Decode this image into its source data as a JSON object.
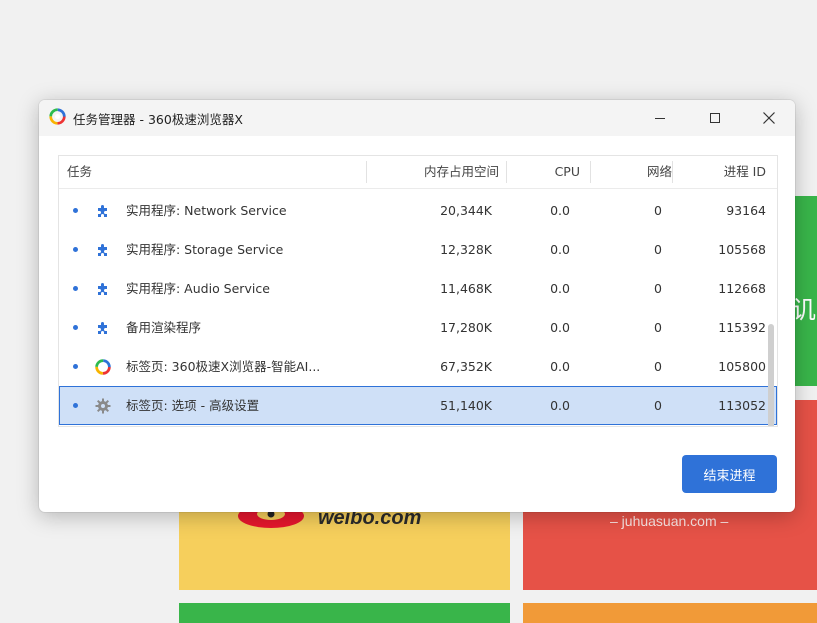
{
  "background": {
    "weibo_text": "weibo.com",
    "juhua_text": "– juhuasuan.com –",
    "edge_glyph": "讥",
    "colors": {
      "green": "#39b54a",
      "yellow": "#f6cf5c",
      "red": "#e65247",
      "orange": "#f19a38"
    }
  },
  "dialog": {
    "title": "任务管理器 - 360极速浏览器X",
    "window_controls": {
      "minimize": "minimize-icon",
      "maximize": "maximize-icon",
      "close": "close-icon"
    },
    "columns": {
      "task": "任务",
      "memory": "内存占用空间",
      "cpu": "CPU",
      "network": "网络",
      "pid": "进程 ID"
    },
    "rows": [
      {
        "icon": "puzzle-icon",
        "name": "实用程序: Network Service",
        "memory": "20,344K",
        "cpu": "0.0",
        "network": "0",
        "pid": "93164",
        "selected": false
      },
      {
        "icon": "puzzle-icon",
        "name": "实用程序: Storage Service",
        "memory": "12,328K",
        "cpu": "0.0",
        "network": "0",
        "pid": "105568",
        "selected": false
      },
      {
        "icon": "puzzle-icon",
        "name": "实用程序: Audio Service",
        "memory": "11,468K",
        "cpu": "0.0",
        "network": "0",
        "pid": "112668",
        "selected": false
      },
      {
        "icon": "puzzle-icon",
        "name": "备用渲染程序",
        "memory": "17,280K",
        "cpu": "0.0",
        "network": "0",
        "pid": "115392",
        "selected": false
      },
      {
        "icon": "browser-logo-icon",
        "name": "标签页: 360极速X浏览器-智能AI...",
        "memory": "67,352K",
        "cpu": "0.0",
        "network": "0",
        "pid": "105800",
        "selected": false
      },
      {
        "icon": "gear-icon",
        "name": "标签页: 选项 - 高级设置",
        "memory": "51,140K",
        "cpu": "0.0",
        "network": "0",
        "pid": "113052",
        "selected": true
      }
    ],
    "end_process_label": "结束进程",
    "accent_color": "#2f72d8",
    "selected_row_color": "#cfe0f7"
  }
}
